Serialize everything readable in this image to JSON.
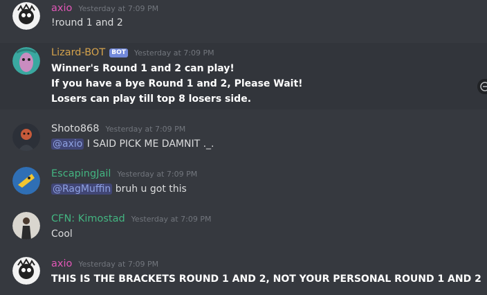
{
  "colors": {
    "background": "#36393f",
    "highlight_background": "#32353b",
    "axio": "#e157b7",
    "lizard_bot": "#d4a24c",
    "shoto": "#dcddde",
    "escaping_jail": "#43b581",
    "kimostad": "#43b581",
    "timestamp": "#72767d",
    "mention_bg": "#414675",
    "mention_text": "#8ea1e1",
    "bot_tag": "#7289da"
  },
  "messages": [
    {
      "author": "axio",
      "timestamp": "Yesterday at 7:09 PM",
      "lines": [
        "!round 1 and 2"
      ]
    },
    {
      "author": "Lizard-BOT",
      "bot_tag": "BOT",
      "timestamp": "Yesterday at 7:09 PM",
      "lines": [
        "Winner's Round 1 and 2 can play!",
        "If you have a bye Round 1 and 2, Please Wait!",
        "Losers can play till top 8 losers side."
      ]
    },
    {
      "author": "Shoto868",
      "timestamp": "Yesterday at 7:09 PM",
      "mention": "@axio",
      "text": " I SAID PICK ME DAMNIT ._."
    },
    {
      "author": "EscapingJail",
      "timestamp": "Yesterday at 7:09 PM",
      "mention": "@RagMuffin",
      "text": " bruh u got this"
    },
    {
      "author": "CFN: Kimostad",
      "timestamp": "Yesterday at 7:09 PM",
      "lines": [
        "Cool"
      ]
    },
    {
      "author": "axio",
      "timestamp": "Yesterday at 7:09 PM",
      "lines": [
        "THIS IS THE BRACKETS ROUND 1 AND 2, NOT YOUR PERSONAL ROUND 1 AND 2"
      ]
    }
  ]
}
